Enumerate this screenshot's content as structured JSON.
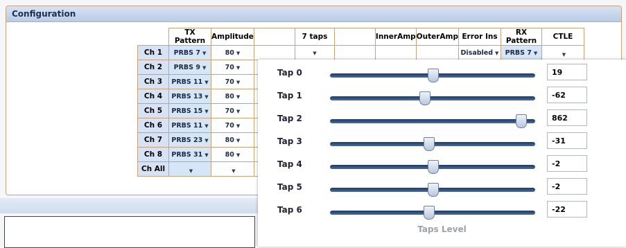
{
  "panel": {
    "title": "Configuration"
  },
  "table": {
    "headers": [
      "TX Pattern",
      "Amplitude",
      "",
      "7 taps",
      "",
      "InnerAmp",
      "OuterAmp",
      "Error Ins",
      "RX Pattern",
      "CTLE"
    ],
    "rows": [
      {
        "label": "Ch 1",
        "tx": "PRBS 7",
        "amp": "80",
        "errorins": "Disabled",
        "rx": "PRBS 7",
        "ctle": ""
      },
      {
        "label": "Ch 2",
        "tx": "PRBS 9",
        "amp": "70"
      },
      {
        "label": "Ch 3",
        "tx": "PRBS 11",
        "amp": "70"
      },
      {
        "label": "Ch 4",
        "tx": "PRBS 13",
        "amp": "80"
      },
      {
        "label": "Ch 5",
        "tx": "PRBS 15",
        "amp": "70"
      },
      {
        "label": "Ch 6",
        "tx": "PRBS 11",
        "amp": "70"
      },
      {
        "label": "Ch 7",
        "tx": "PRBS 23",
        "amp": "80"
      },
      {
        "label": "Ch 8",
        "tx": "PRBS 31",
        "amp": "80"
      },
      {
        "label": "Ch All",
        "tx": "",
        "amp": ""
      }
    ]
  },
  "taps": {
    "items": [
      {
        "label": "Tap 0",
        "value": "19",
        "level": 0.5
      },
      {
        "label": "Tap 1",
        "value": "-62",
        "level": 0.46
      },
      {
        "label": "Tap 2",
        "value": "862",
        "level": 0.93
      },
      {
        "label": "Tap 3",
        "value": "-31",
        "level": 0.48
      },
      {
        "label": "Tap 4",
        "value": "-2",
        "level": 0.5
      },
      {
        "label": "Tap 5",
        "value": "-2",
        "level": 0.5
      },
      {
        "label": "Tap 6",
        "value": "-22",
        "level": 0.48
      }
    ],
    "footer": "Taps Level"
  }
}
